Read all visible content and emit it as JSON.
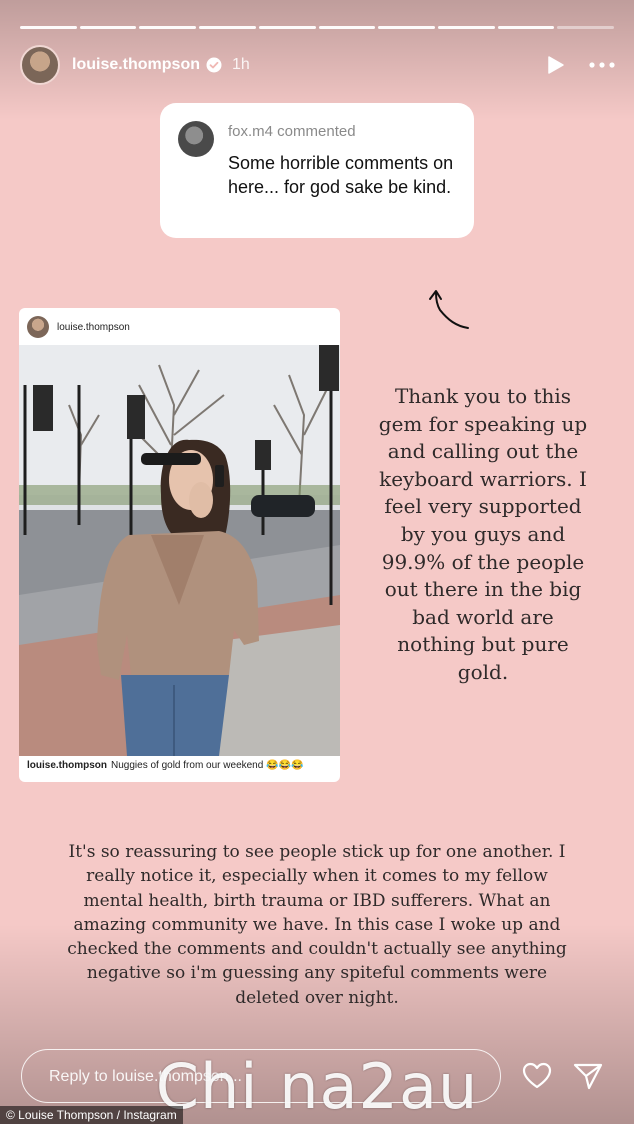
{
  "story": {
    "progress_segments": 10,
    "progress_completed": 9,
    "header": {
      "username": "louise.thompson",
      "verified_icon": "verified-badge-icon",
      "time_ago": "1h",
      "play_icon": "play-icon",
      "more_icon": "more-options-icon"
    },
    "comment_card": {
      "commenter": "fox.m4",
      "meta": "fox.m4 commented",
      "text": "Some horrible comments on here... for god sake be kind."
    },
    "shared_post": {
      "username": "louise.thompson",
      "caption_user": "louise.thompson",
      "caption_text": "Nuggies of gold from our weekend 😂😂😂"
    },
    "message_1": "Thank you to this gem for speaking up and calling out the keyboard warriors. I feel very supported by you guys and 99.9% of the people out there in the big bad world are nothing but pure gold.",
    "message_2": "It's so reassuring to see people stick up for one another. I really notice it, especially when it comes to my fellow mental health, birth trauma or IBD sufferers. What an amazing community we have. In this case I woke up and checked the comments and couldn't actually see anything negative so i'm guessing any spiteful comments were deleted over night.",
    "reply_placeholder": "Reply to louise.thompson...",
    "like_icon": "heart-icon",
    "send_icon": "send-icon"
  },
  "overlay": {
    "credit": "© Louise Thompson / Instagram",
    "watermark": "Chi na2au"
  },
  "colors": {
    "background": "#f5c9c7",
    "text_dark": "#2f2a2a"
  }
}
